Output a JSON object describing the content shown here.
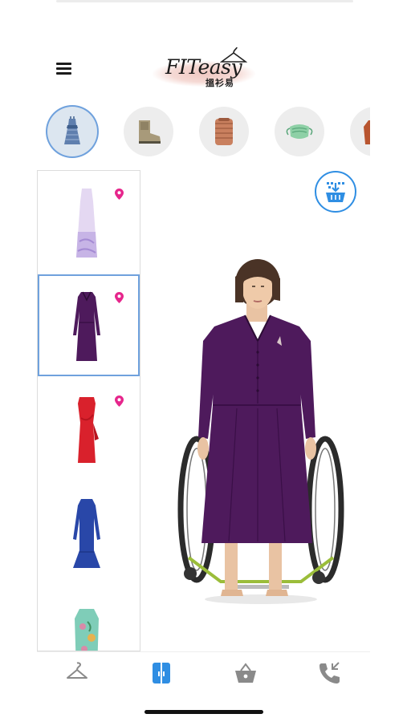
{
  "app": {
    "logo_text": "FITeasy",
    "logo_subtitle": "搵衫易"
  },
  "categories": [
    {
      "name": "dresses",
      "icon": "dress-icon",
      "selected": true
    },
    {
      "name": "boots",
      "icon": "boot-icon",
      "selected": false
    },
    {
      "name": "tops",
      "icon": "sweater-icon",
      "selected": false
    },
    {
      "name": "masks",
      "icon": "face-mask-icon",
      "selected": false
    },
    {
      "name": "jackets",
      "icon": "jacket-icon",
      "selected": false
    }
  ],
  "garments": [
    {
      "color": "#c7b4e6",
      "accent": "#a58bd4",
      "selected": false,
      "pinned": true
    },
    {
      "color": "#4e1a5c",
      "accent": "#3a0f47",
      "selected": true,
      "pinned": true
    },
    {
      "color": "#d9212c",
      "accent": "#b8141f",
      "selected": false,
      "pinned": true
    },
    {
      "color": "#2947a8",
      "accent": "#1d3688",
      "selected": false,
      "pinned": false
    },
    {
      "color": "#7fcdb8",
      "accent": "#d98aa8",
      "selected": false,
      "pinned": false
    }
  ],
  "colors": {
    "accent": "#2f8ee3",
    "pin": "#e6268c",
    "selection": "#6fa1dd",
    "outfit": "#4e1a5c"
  },
  "bottom_nav": [
    {
      "icon": "hanger-icon",
      "active": false
    },
    {
      "icon": "wardrobe-icon",
      "active": true
    },
    {
      "icon": "basket-icon",
      "active": false
    },
    {
      "icon": "phone-icon",
      "active": false
    }
  ]
}
